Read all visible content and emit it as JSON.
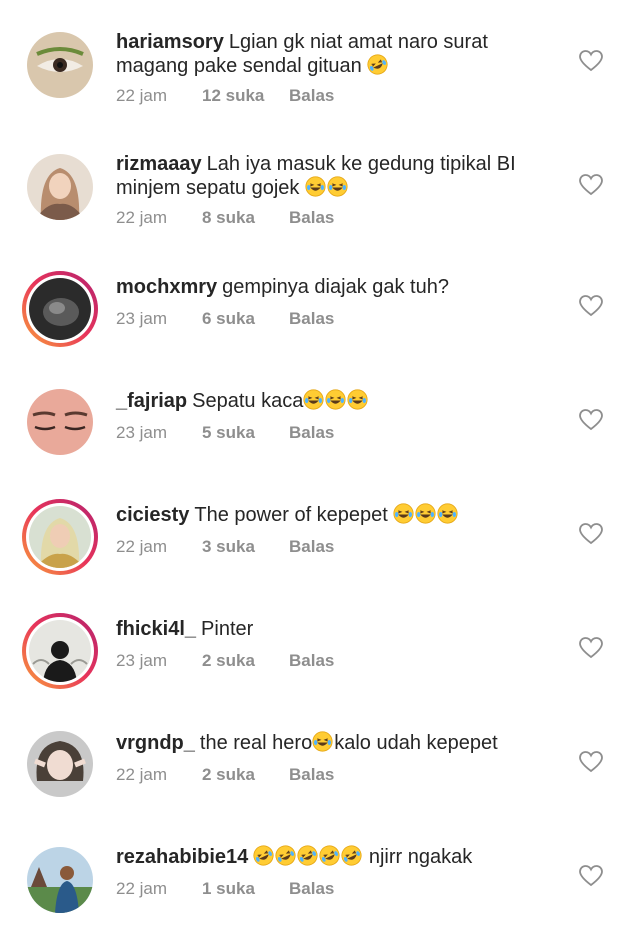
{
  "reply_label": "Balas",
  "comments": [
    {
      "username": "hariamsory",
      "text": "Lgian gk niat amat naro surat magang pake sendal gituan",
      "emoji": "🤣",
      "emoji_count": 1,
      "time": "22 jam",
      "likes": "12 suka",
      "avatar": "eye",
      "ring": false
    },
    {
      "username": "rizmaaay",
      "text": "Lah iya masuk ke gedung tipikal BI minjem sepatu gojek",
      "emoji": "😂",
      "emoji_count": 2,
      "time": "22 jam",
      "likes": "8 suka",
      "avatar": "hijab-woman",
      "ring": false
    },
    {
      "username": "mochxmry",
      "text": "gempinya diajak gak tuh?",
      "emoji": "",
      "emoji_count": 0,
      "time": "23 jam",
      "likes": "6 suka",
      "avatar": "dark-photo",
      "ring": true
    },
    {
      "username": "_fajriap",
      "text": "Sepatu kaca",
      "emoji": "😂",
      "emoji_count": 3,
      "time": "23 jam",
      "likes": "5 suka",
      "avatar": "closed-eyes",
      "ring": false
    },
    {
      "username": "ciciesty",
      "text": "The power of kepepet",
      "emoji": "😂",
      "emoji_count": 3,
      "time": "22 jam",
      "likes": "3 suka",
      "avatar": "hijab-woman-2",
      "ring": true
    },
    {
      "username": "fhicki4l_",
      "text": "Pinter",
      "emoji": "",
      "emoji_count": 0,
      "time": "23 jam",
      "likes": "2 suka",
      "avatar": "silhouette",
      "ring": true
    },
    {
      "username": "vrgndp_",
      "text": "the real hero",
      "emoji": "😂",
      "emoji_count": 1,
      "text_after": "kalo udah kepepet",
      "time": "22 jam",
      "likes": "2 suka",
      "avatar": "selfie",
      "ring": false
    },
    {
      "username": "rezahabibie14",
      "text": "",
      "emoji": "🤣",
      "emoji_count": 5,
      "text_after": "njirr ngakak",
      "time": "22 jam",
      "likes": "1 suka",
      "avatar": "outdoor-man",
      "ring": false
    }
  ]
}
